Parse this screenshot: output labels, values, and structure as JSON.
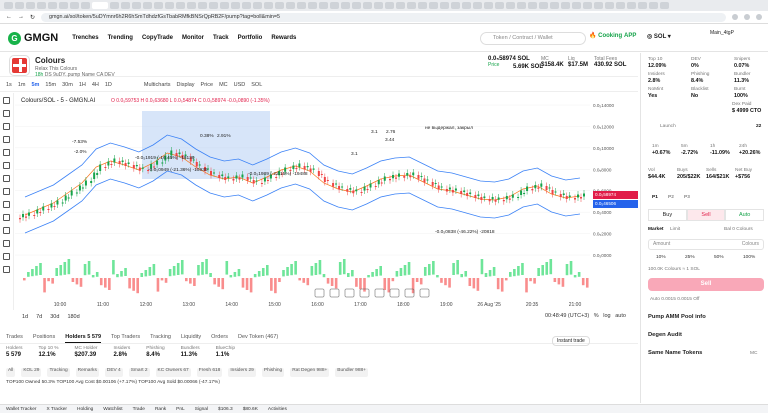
{
  "browser": {
    "url": "gmgn.ai/sol/token/5uDYmnr6h2R6hSmTdhdzfGsTbabRMfkBNSrQpRB2F/pump?tag=boll&min=5"
  },
  "nav": {
    "logo": "GMGN",
    "items": [
      "Trenches",
      "Trending",
      "CopyTrade",
      "Monitor",
      "Track",
      "Portfolio",
      "Rewards"
    ],
    "search_placeholder": "Token / Contract / Wallet",
    "cooking": "Cooking",
    "app": "APP",
    "sol": "SOL",
    "account": "Main_4tgP"
  },
  "token": {
    "name": "Colours",
    "subtitle": "Relax This Colours",
    "age": "18h",
    "ticker": "DS 9uDY..pump",
    "tags": [
      "Name",
      "CA",
      "DEV"
    ],
    "price": "0.0₅58974 SOL",
    "vol": "5.69K SOL",
    "mc": "$158.4K",
    "liq": "$17.5M",
    "supply": "430.92 SOL",
    "price_lbl": "Price",
    "vol_lbl": "Vol 24h",
    "liq_lbl": "Liq",
    "mc_lbl": "MC",
    "supply_lbl": "Total Fees"
  },
  "toolbar": {
    "intervals": [
      "1s",
      "1m",
      "5m",
      "15m",
      "30m",
      "1H",
      "4H",
      "1D"
    ],
    "active": "5m",
    "extra": [
      "Multicharts",
      "Display",
      "Price",
      "MC",
      "USD",
      "SOL"
    ]
  },
  "chart_data": {
    "type": "candlestick",
    "title": "Colours/SOL - 5 - GMGN.AI",
    "ohlc": "O 0.0₅59753 H 0.0₅63680 L 0.0₅54874 C 0.0₅58974 -0.0₅0890 (-1.35%)",
    "x_ticks": [
      "10:00",
      "11:00",
      "12:00",
      "13:00",
      "14:00",
      "15:00",
      "16:00",
      "17:00",
      "18:00",
      "19:00",
      "26 Aug '25",
      "20:35",
      "21:00"
    ],
    "y_ticks": [
      "0.0₅14000",
      "0.0₅12000",
      "0.0₅10000",
      "0.0₅8000",
      "0.0₅6000",
      "0.0₅4000",
      "0.0₅2000",
      "0.0₅0000"
    ],
    "annotations": [
      "-0.0₅1919 (-16.45%) -18139",
      "-0.0₅0949 (-21.36%) -15939",
      "-0.0₅1989 (-22.15%) -19488",
      "-0.0₅0838 (-46.22%) -20818",
      "не выдержал, закрыл",
      "-7.53%",
      "-2.0%",
      "0.38%",
      "2.91%",
      "3.1",
      "2.76",
      "3.44",
      "3.1"
    ],
    "price_badge": "0.0₅58974",
    "badge2": "0.0₅46506",
    "price_series": [
      4.0,
      4.6,
      5.2,
      6.2,
      7.2,
      8.8,
      9.4,
      9.0,
      8.5,
      9.2,
      10.2,
      9.8,
      8.8,
      8.0,
      7.6,
      7.8,
      7.2,
      7.8,
      8.5,
      8.9,
      8.4,
      7.2,
      6.6,
      6.3,
      6.9,
      7.6,
      7.9,
      8.0,
      7.3,
      6.6,
      6.4,
      6.0,
      5.6,
      5.5,
      5.8,
      6.6,
      6.9,
      6.1,
      5.7,
      5.9
    ],
    "ylim": [
      0,
      15
    ]
  },
  "bottom": {
    "ranges": [
      "1d",
      "7d",
      "30d",
      "180d"
    ],
    "clock": "00:48:49 (UTC+3)",
    "pct": "%",
    "log": "log",
    "auto": "auto"
  },
  "tabs2": [
    "Trades",
    "Positions",
    "Holders 5 579",
    "Top Traders",
    "Tracking",
    "Liquidity",
    "Orders",
    "Dev Token (467)"
  ],
  "instant": "Instant trade",
  "holders": [
    {
      "l": "Holders",
      "v": "5 579"
    },
    {
      "l": "Top 10 %",
      "v": "12.1%"
    },
    {
      "l": "MC Holder",
      "v": "$207.39"
    },
    {
      "l": "Insiders",
      "v": "2.8%"
    },
    {
      "l": "Phishing",
      "v": "8.4%"
    },
    {
      "l": "Bundlers",
      "v": "11.3%"
    },
    {
      "l": "BlueChip",
      "v": "1.1%"
    }
  ],
  "filters": [
    "All",
    "KOL 29",
    "Tracking",
    "Remarks",
    "DEV 4",
    "Smart 2",
    "KC Owners 67",
    "Fresh 618",
    "Insiders 29",
    "Phishing",
    "Rat Degen 988+",
    "Bundler 988+"
  ],
  "toprow": "TOP100 Owned 50.3%  TOP100 Avg Cost $0.00106 (+7.17%)  TOP100 Avg Sold $0.00066 (-47.17%)",
  "dock": [
    "Wallet Tracker",
    "X Tracker",
    "Holding",
    "Watchlist",
    "Trade",
    "Rank",
    "PnL",
    "Signal",
    "$106.3",
    "$80.6K",
    "Activities"
  ],
  "rp": {
    "stats": [
      {
        "l": "Top 10",
        "v": "12.09%",
        "c": "g"
      },
      {
        "l": "DEV",
        "v": "0%",
        "c": "g"
      },
      {
        "l": "Snipers",
        "v": "0.07%",
        "c": "g"
      },
      {
        "l": "Insiders",
        "v": "2.8%"
      },
      {
        "l": "Phishing",
        "v": "8.4%"
      },
      {
        "l": "Bundler",
        "v": "11.3%"
      },
      {
        "l": "NoMint",
        "v": "Yes",
        "c": "g"
      },
      {
        "l": "Blacklist",
        "v": "No",
        "c": "g"
      },
      {
        "l": "Burnt",
        "v": "100%",
        "c": "g"
      }
    ],
    "dex": "Dex Paid",
    "dexv": "$ 4999 CTO",
    "launch": "Launch",
    "launchv": "22",
    "changes": [
      {
        "l": "1m",
        "v": "+0.67%",
        "c": "g"
      },
      {
        "l": "5m",
        "v": "-2.72%",
        "c": "r"
      },
      {
        "l": "1h",
        "v": "-11.09%",
        "c": "r"
      },
      {
        "l": "24h",
        "v": "+20.26%",
        "c": "g"
      }
    ],
    "vol": [
      {
        "l": "Vol",
        "v": "$44.4K"
      },
      {
        "l": "Buys",
        "v": "205/$22K",
        "c": "g"
      },
      {
        "l": "Sells",
        "v": "164/$21K",
        "c": "r"
      },
      {
        "l": "Net Buy",
        "v": "+$756",
        "c": "g"
      }
    ],
    "presets": [
      "P1",
      "P2",
      "P3"
    ],
    "buy": "Buy",
    "sell": "Sell",
    "auto": "Auto",
    "market": "Market",
    "limit": "Limit",
    "bal": "Bal 0 Colours",
    "amount_lbl": "Amount",
    "amount_unit": "Colours",
    "pcts": [
      "10%",
      "25%",
      "50%",
      "100%"
    ],
    "hint": "100.0K Colours ≈ 1 SOL",
    "sellbtn": "Sell",
    "meta": "Auto  0.0015  0.0015  Off",
    "pool": "Pump AMM Pool info",
    "audit": "Degen Audit",
    "same": "Same Name Tokens",
    "mc": "MC",
    "status": "Stable  39 ms  96 TPS"
  }
}
